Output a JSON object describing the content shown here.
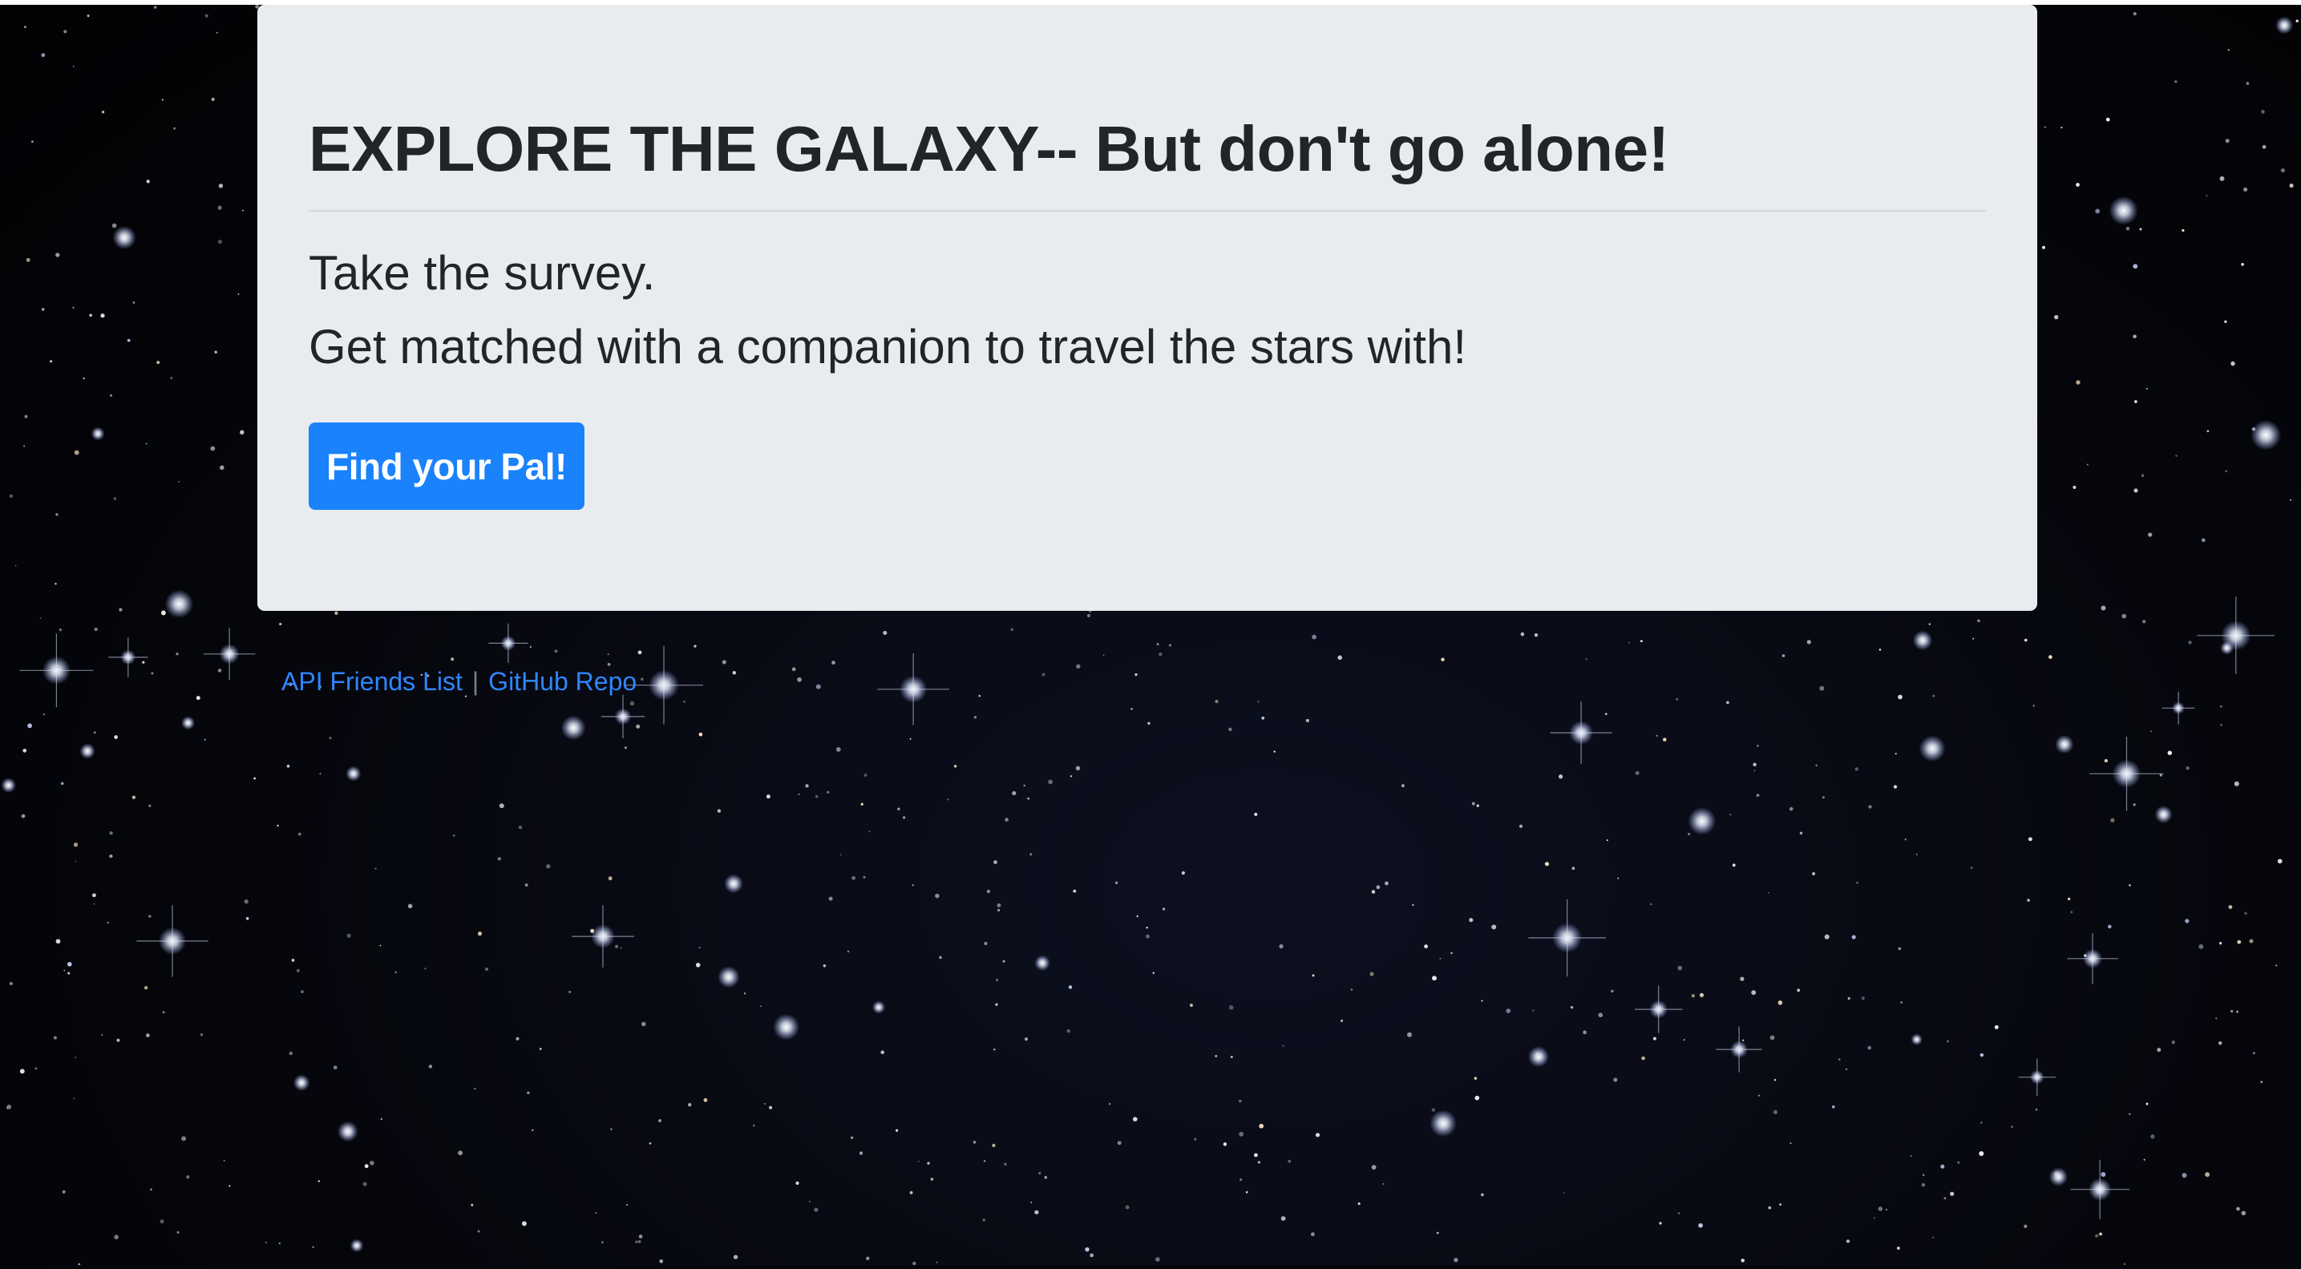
{
  "hero": {
    "title": "EXPLORE THE GALAXY-- But don't go alone!",
    "line1": "Take the survey.",
    "line2": "Get matched with a companion to travel the stars with!",
    "button_label": "Find your Pal!"
  },
  "footer": {
    "link1": "API Friends List",
    "separator": "|",
    "link2": "GitHub Repo"
  },
  "colors": {
    "button": "#1a82fb",
    "panel": "#e9ecef",
    "link": "#2f86ff",
    "background": "#05060b"
  }
}
